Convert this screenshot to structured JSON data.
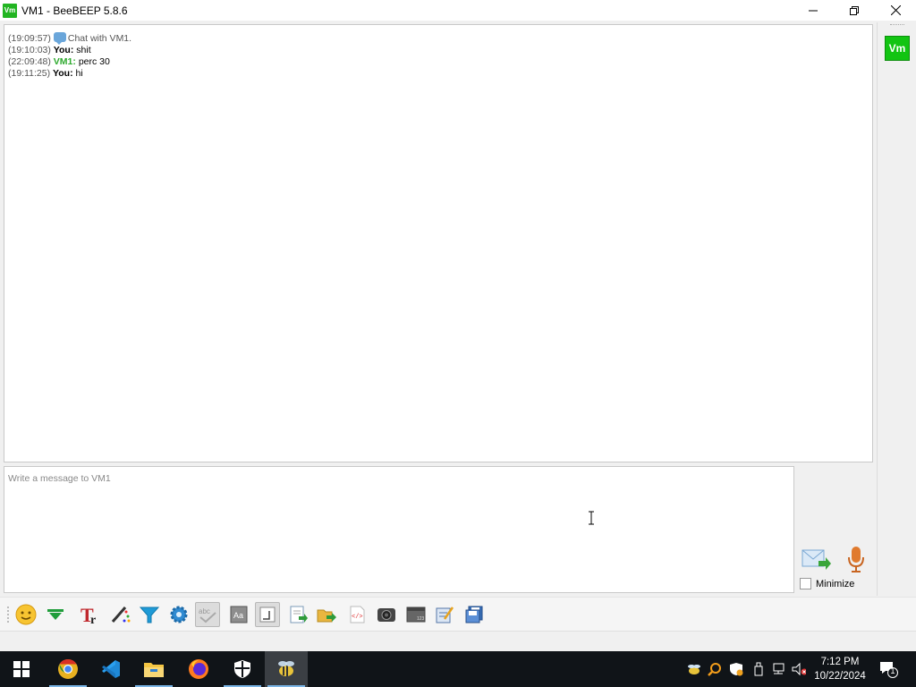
{
  "window": {
    "icon_text": "Vm",
    "title": "VM1 - BeeBEEP 5.8.6"
  },
  "chat": {
    "messages": [
      {
        "time": "(19:09:57)",
        "sender": "",
        "text": "Chat with VM1.",
        "kind": "system"
      },
      {
        "time": "(19:10:03)",
        "sender": "You:",
        "text": "shit",
        "kind": "self"
      },
      {
        "time": "(22:09:48)",
        "sender": "VM1:",
        "text": "perc 30",
        "kind": "peer"
      },
      {
        "time": "(19:11:25)",
        "sender": "You:",
        "text": "hi",
        "kind": "self"
      }
    ]
  },
  "user_panel": {
    "avatar_text": "Vm",
    "avatar_color": "#12c412"
  },
  "input": {
    "placeholder": "Write a message to VM1"
  },
  "controls": {
    "minimize_label": "Minimize",
    "minimize_checked": false
  },
  "toolbar": {
    "icons": [
      "emoticon-icon",
      "dropdown-arrow-icon",
      "font-icon",
      "color-pen-icon",
      "filter-icon",
      "settings-gear-icon",
      "spellcheck-icon",
      "dictionary-icon",
      "compact-view-icon",
      "save-chat-icon",
      "send-file-icon",
      "html-icon",
      "screenshot-icon",
      "window-icon",
      "notes-icon",
      "save-icon"
    ]
  },
  "taskbar": {
    "time": "7:12 PM",
    "date": "10/22/2024",
    "notification_count": "1",
    "apps": [
      "start-icon",
      "chrome-icon",
      "vscode-icon",
      "file-explorer-icon",
      "firefox-icon",
      "security-icon",
      "beebeep-icon"
    ]
  }
}
